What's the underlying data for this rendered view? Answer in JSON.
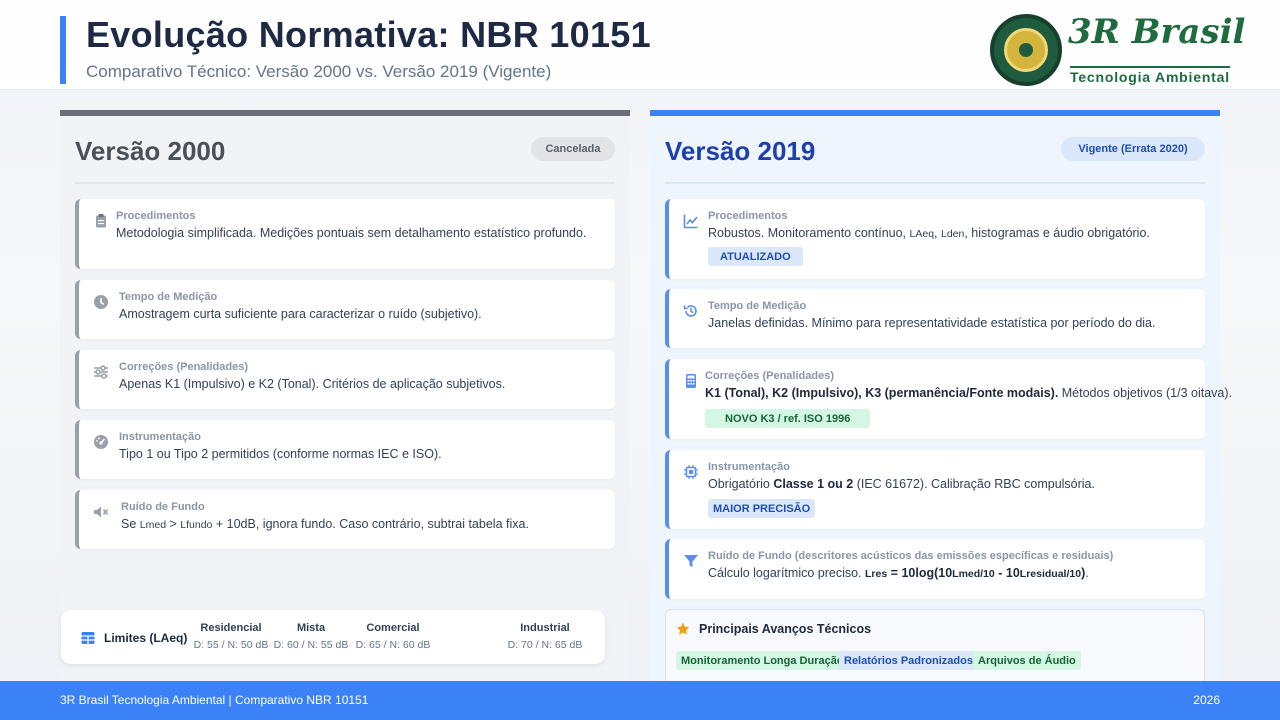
{
  "header": {
    "title": "Evolução Normativa: NBR 10151",
    "subtitle": "Comparativo Técnico: Versão 2000 vs. Versão 2019 (Vigente)",
    "logo_brand": "3R Brasil",
    "logo_tagline": "Tecnologia Ambiental"
  },
  "left": {
    "title": "Versão 2000",
    "badge": "Cancelada",
    "cards": [
      {
        "label": "Procedimentos",
        "text": "Metodologia simplificada. Medições pontuais sem detalhamento estatístico profundo.",
        "icon": "clipboard-icon"
      },
      {
        "label": "Tempo de Medição",
        "text": "Amostragem curta suficiente para caracterizar o ruído (subjetivo).",
        "icon": "clock-icon"
      },
      {
        "label": "Correções (Penalidades)",
        "text": "Apenas K1 (Impulsivo) e K2 (Tonal). Critérios de aplicação subjetivos.",
        "icon": "sliders-icon"
      },
      {
        "label": "Instrumentação",
        "text": "Tipo 1 ou Tipo 2 permitidos (conforme normas IEC e ISO).",
        "icon": "gauge-icon"
      },
      {
        "label": "Ruído de Fundo",
        "icon": "mute-icon",
        "p1": "Se ",
        "s1": "Lmed",
        "p2": " > ",
        "s2": "Lfundo",
        "p3": " + 10dB, ignora fundo. Caso contrário, subtrai tabela fixa."
      }
    ],
    "limits": {
      "title": "Limites (LAeq)",
      "columns": [
        {
          "name": "Residencial",
          "value": "D: 55 / N: 50 dB"
        },
        {
          "name": "Mista",
          "value": "D: 60 / N: 55 dB"
        },
        {
          "name": "Comercial",
          "value": "D: 65 / N: 60 dB"
        },
        {
          "name": "Industrial",
          "value": "D: 70 / N: 65 dB"
        }
      ]
    }
  },
  "right": {
    "title": "Versão 2019",
    "badge": "Vigente (Errata 2020)",
    "cards": [
      {
        "label": "Procedimentos",
        "icon": "chart-line-icon",
        "p1": "Robustos. Monitoramento contínuo, ",
        "s1": "LAeq",
        "p2": ", ",
        "s2": "Lden",
        "p3": ", histogramas e áudio obrigatório.",
        "tag": "ATUALIZADO"
      },
      {
        "label": "Tempo de Medição",
        "icon": "history-icon",
        "text": "Janelas definidas. Mínimo para representatividade estatística por período do dia."
      },
      {
        "label": "Correções (Penalidades)",
        "icon": "calculator-icon",
        "bold": "K1 (Tonal), K2 (Impulsivo), K3 (permanência/Fonte modais).",
        "rest": " Métodos objetivos (1/3 oitava).",
        "tag": "NOVO K3 / ref. ISO 1996"
      },
      {
        "label": "Instrumentação",
        "icon": "chip-icon",
        "p1": "Obrigatório ",
        "bold": "Classe 1 ou 2",
        "p2": "  (IEC 61672). Calibração RBC compulsória.",
        "tag": "MAIOR PRECISÃO"
      },
      {
        "label": "Ruído de Fundo (descritores acústicos das emissões específicas e residuais)",
        "icon": "filter-icon",
        "p1": "Cálculo logarítmico preciso. ",
        "f1": "Lres",
        "f2": " = 10log(10",
        "f3": "Lmed/10",
        "f4": " - 10",
        "f5": "Lresidual/10",
        "f6": ")",
        "p2": "."
      }
    ],
    "advances": {
      "title": "Principais Avanços Técnicos",
      "chips": [
        "Monitoramento Longa Duração",
        "Relatórios Padronizados",
        "Arquivos de Áudio"
      ]
    }
  },
  "footer": {
    "left": "3R Brasil Tecnologia Ambiental | Comparativo NBR 10151",
    "right": "2026"
  },
  "colors": {
    "accent": "#3b82f6",
    "old_accent": "#6b6f77",
    "new_title": "#1e40af",
    "tag_green": "#166534",
    "brand_green": "#1f6b40"
  }
}
